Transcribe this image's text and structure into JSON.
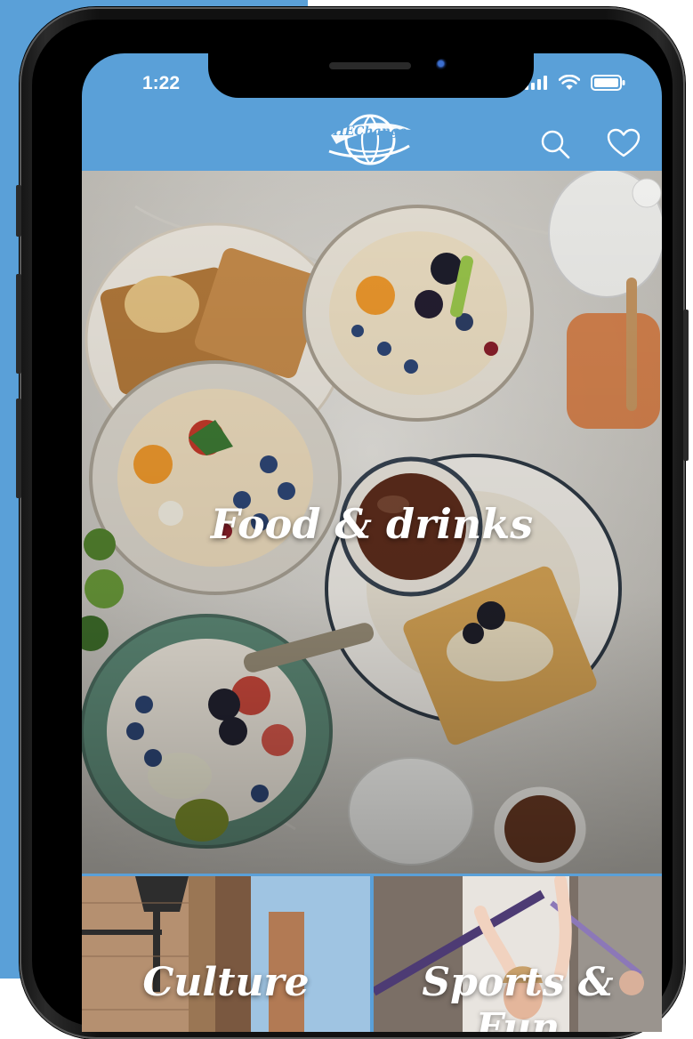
{
  "status_bar": {
    "time": "1:22"
  },
  "header": {
    "logo_text": "HEChange"
  },
  "categories": [
    {
      "title": "Food & drinks"
    },
    {
      "title": "Culture"
    },
    {
      "title": "Sports & Fun"
    }
  ],
  "colors": {
    "accent": "#5aa0d8",
    "header_bg": "#5aa0d8",
    "text_on_image": "#ffffff"
  }
}
